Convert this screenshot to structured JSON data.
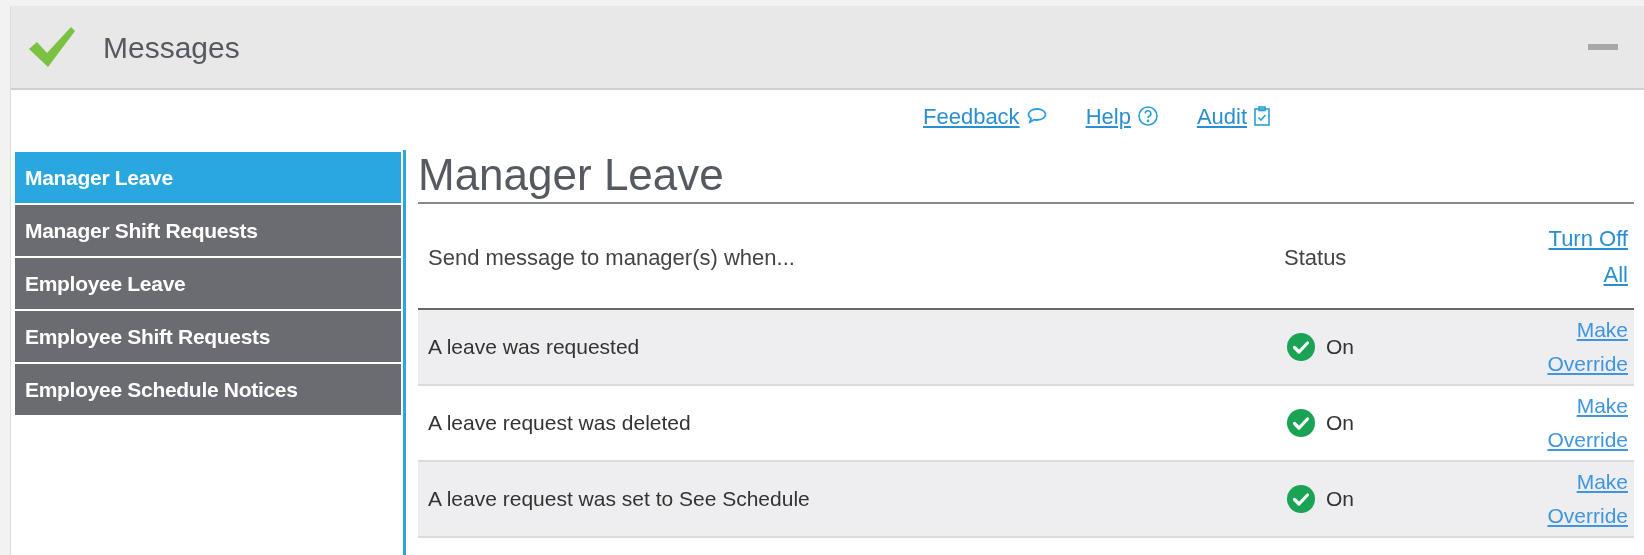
{
  "window": {
    "title": "Messages"
  },
  "top_links": [
    {
      "label": "Feedback",
      "kind": "feedback"
    },
    {
      "label": "Help",
      "kind": "help"
    },
    {
      "label": "Audit",
      "kind": "audit"
    }
  ],
  "sidebar": {
    "items": [
      {
        "label": "Manager Leave",
        "selected": true
      },
      {
        "label": "Manager Shift Requests",
        "selected": false
      },
      {
        "label": "Employee Leave",
        "selected": false
      },
      {
        "label": "Employee Shift Requests",
        "selected": false
      },
      {
        "label": "Employee Schedule Notices",
        "selected": false
      }
    ]
  },
  "heading": "Manager Leave",
  "table": {
    "columns": [
      "Send message to manager(s) when...",
      "Status"
    ],
    "header_action": [
      "Turn Off",
      "All"
    ],
    "rows": [
      {
        "event": "A leave was requested",
        "on": true,
        "status": "On",
        "action": [
          "Make",
          "Override"
        ]
      },
      {
        "event": "A leave request was deleted",
        "on": true,
        "status": "On",
        "action": [
          "Make",
          "Override"
        ]
      },
      {
        "event": "A leave request was set to See Schedule",
        "on": true,
        "status": "On",
        "action": [
          "Make",
          "Override"
        ]
      }
    ]
  }
}
